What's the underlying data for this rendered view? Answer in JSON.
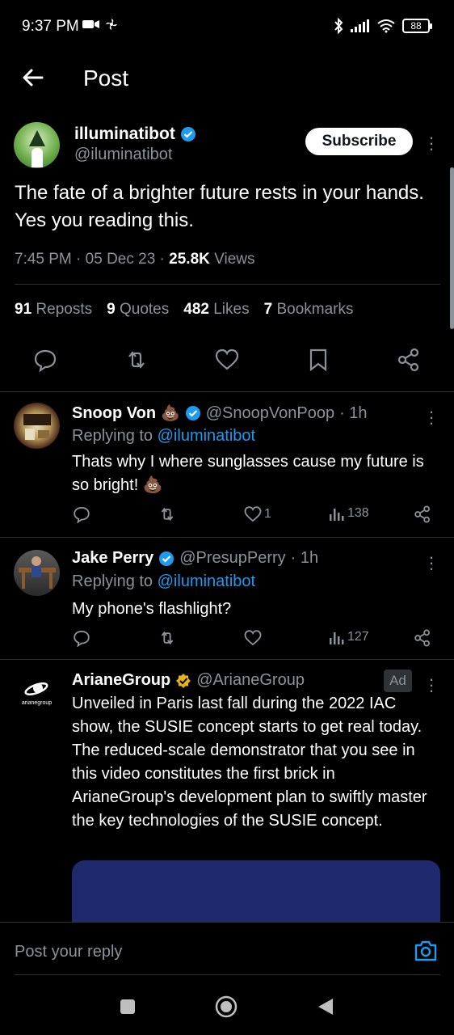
{
  "status_bar": {
    "time": "9:37 PM",
    "battery": "88"
  },
  "header": {
    "title": "Post"
  },
  "main_post": {
    "display_name": "illuminatibot",
    "handle": "@iluminatibot",
    "subscribe_label": "Subscribe",
    "text": "The fate of a brighter future rests in your hands. Yes you reading this.",
    "time": "7:45 PM",
    "date": "05 Dec 23",
    "views_count": "25.8K",
    "views_label": "Views",
    "stats": {
      "reposts_count": "91",
      "reposts_label": "Reposts",
      "quotes_count": "9",
      "quotes_label": "Quotes",
      "likes_count": "482",
      "likes_label": "Likes",
      "bookmarks_count": "7",
      "bookmarks_label": "Bookmarks"
    }
  },
  "replies": [
    {
      "display_name": "Snoop Von",
      "emoji": "💩",
      "handle": "@SnoopVonPoop",
      "time": "· 1h",
      "replying_prefix": "Replying to",
      "replying_to": "@iluminatibot",
      "text": "Thats why I where sunglasses cause my future is so bright! 💩",
      "likes": "1",
      "views": "138"
    },
    {
      "display_name": "Jake Perry",
      "handle": "@PresupPerry",
      "time": "· 1h",
      "replying_prefix": "Replying to",
      "replying_to": "@iluminatibot",
      "text": "My phone's flashlight?",
      "views": "127"
    },
    {
      "display_name": "ArianeGroup",
      "handle": "@ArianeGroup",
      "ad_label": "Ad",
      "avatar_text": "arianegroup",
      "text": "Unveiled in Paris last fall during the 2022 IAC show, the SUSIE concept starts to get real today. The reduced-scale demonstrator that you see in this video constitutes the first brick in ArianeGroup's development plan to swiftly master the key technologies of the SUSIE concept."
    }
  ],
  "composer": {
    "placeholder": "Post your reply"
  },
  "colors": {
    "accent": "#1d9bf0",
    "muted": "#8b9299",
    "divider": "#2f3336",
    "verified_gold": "#e8b21c"
  }
}
